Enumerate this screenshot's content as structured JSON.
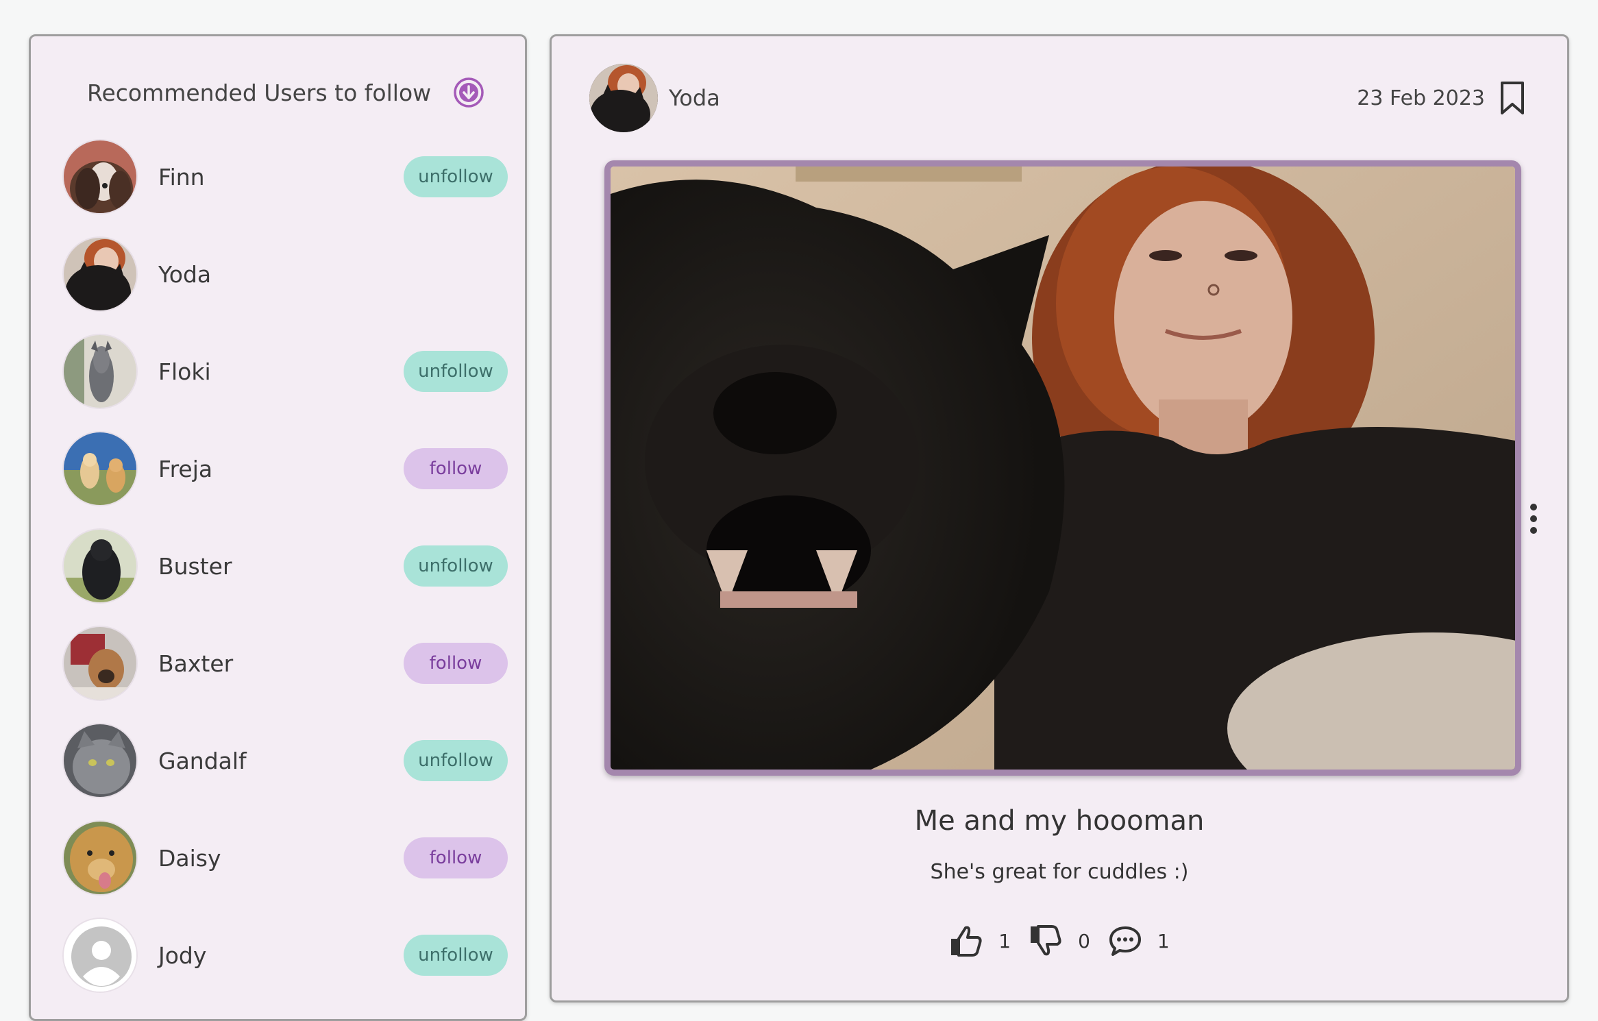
{
  "sidebar": {
    "title": "Recommended Users to follow",
    "header_icon": "download-circle-icon",
    "users": [
      {
        "name": "Finn",
        "button": "unfollow",
        "avatar": "spaniel"
      },
      {
        "name": "Yoda",
        "button": "",
        "avatar": "black-cat"
      },
      {
        "name": "Floki",
        "button": "unfollow",
        "avatar": "greyhound"
      },
      {
        "name": "Freja",
        "button": "follow",
        "avatar": "two-retrievers"
      },
      {
        "name": "Buster",
        "button": "unfollow",
        "avatar": "black-dog"
      },
      {
        "name": "Baxter",
        "button": "follow",
        "avatar": "boxer-mix"
      },
      {
        "name": "Gandalf",
        "button": "unfollow",
        "avatar": "grey-cat"
      },
      {
        "name": "Daisy",
        "button": "follow",
        "avatar": "golden-retriever"
      },
      {
        "name": "Jody",
        "button": "unfollow",
        "avatar": "default-user"
      }
    ]
  },
  "post": {
    "author": "Yoda",
    "date": "23 Feb 2023",
    "title": "Me and my hoooman",
    "body": "She's great for cuddles :)",
    "likes": "1",
    "dislikes": "0",
    "comments": "1"
  },
  "colors": {
    "panel_bg": "#f4edf4",
    "unfollow_bg": "#a9e3d8",
    "follow_bg": "#dcc3ea",
    "accent_purple": "#9b59b6",
    "photo_border": "#a487ad"
  }
}
